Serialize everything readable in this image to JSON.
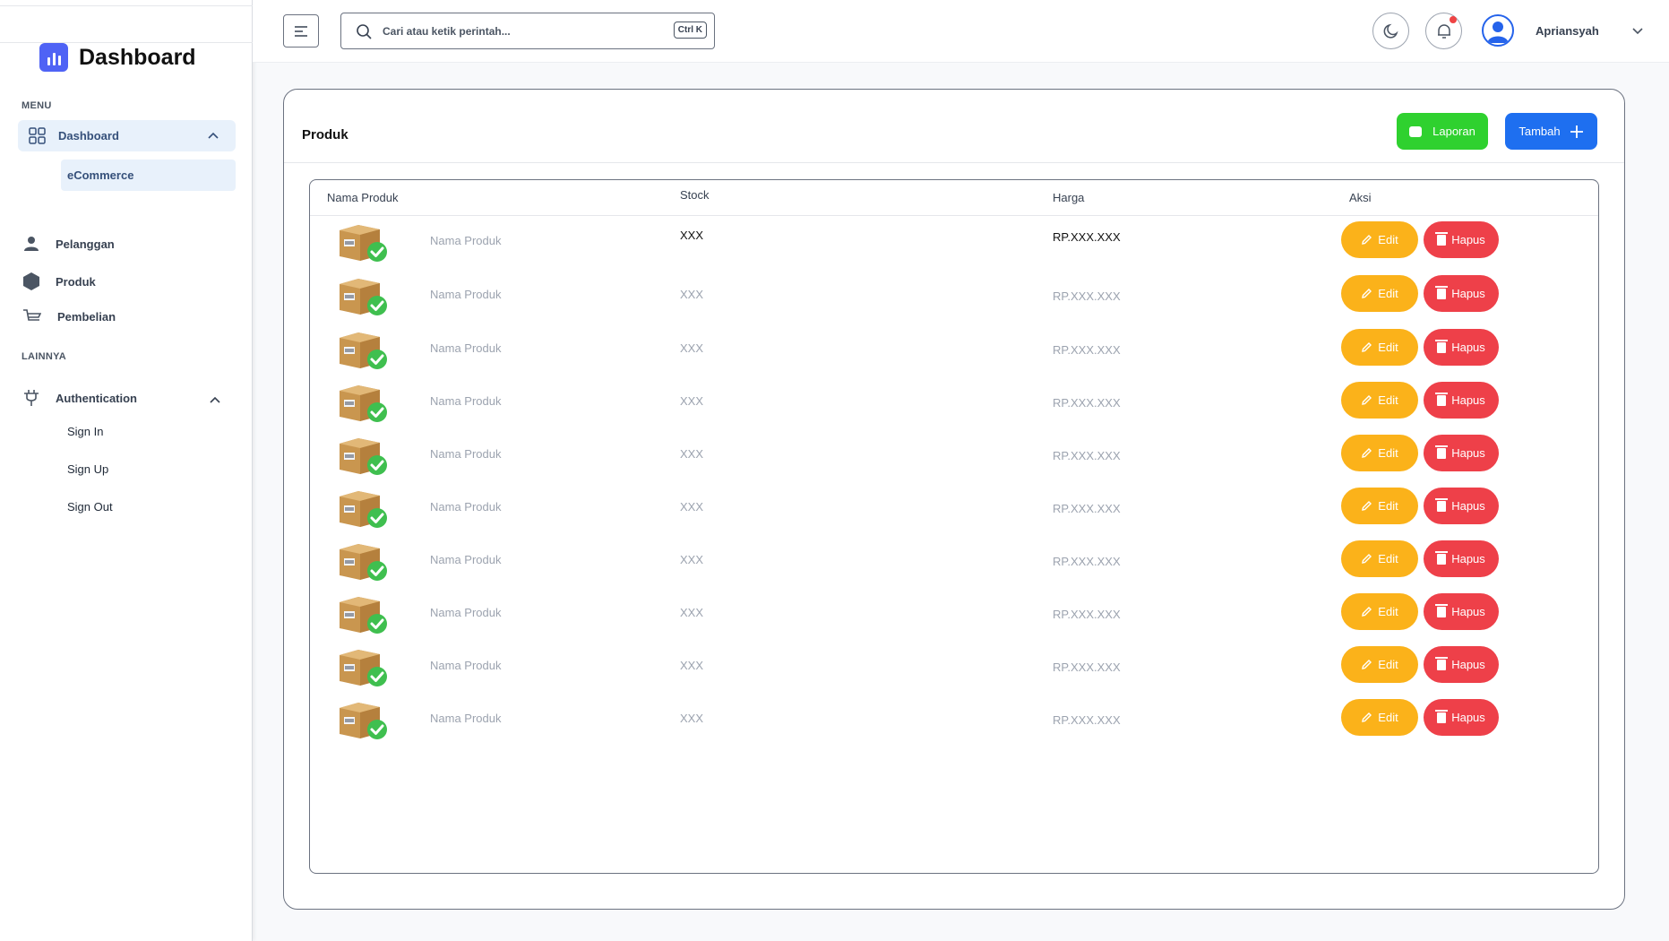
{
  "app": {
    "title": "Dashboard"
  },
  "sidebar": {
    "menu_label": "MENU",
    "dashboard_label": "Dashboard",
    "dashboard_sub": "eCommerce",
    "items": [
      {
        "label": "Pelanggan",
        "icon": "user-icon"
      },
      {
        "label": "Produk",
        "icon": "hexagon-icon"
      },
      {
        "label": "Pembelian",
        "icon": "cart-icon"
      }
    ],
    "other_label": "LAINNYA",
    "auth_label": "Authentication",
    "auth_items": [
      "Sign In",
      "Sign Up",
      "Sign Out"
    ]
  },
  "topbar": {
    "search_placeholder": "Cari atau ketik perintah...",
    "shortcut": "Ctrl K",
    "username": "Apriansyah"
  },
  "card": {
    "title": "Produk",
    "report_label": "Laporan",
    "add_label": "Tambah"
  },
  "table": {
    "headers": {
      "name": "Nama Produk",
      "stock": "Stock",
      "price": "Harga",
      "action": "Aksi"
    },
    "edit_label": "Edit",
    "delete_label": "Hapus",
    "rows": [
      {
        "name": "Nama Produk",
        "stock": "XXX",
        "price": "RP.XXX.XXX"
      },
      {
        "name": "Nama Produk",
        "stock": "XXX",
        "price": "RP.XXX.XXX"
      },
      {
        "name": "Nama Produk",
        "stock": "XXX",
        "price": "RP.XXX.XXX"
      },
      {
        "name": "Nama Produk",
        "stock": "XXX",
        "price": "RP.XXX.XXX"
      },
      {
        "name": "Nama Produk",
        "stock": "XXX",
        "price": "RP.XXX.XXX"
      },
      {
        "name": "Nama Produk",
        "stock": "XXX",
        "price": "RP.XXX.XXX"
      },
      {
        "name": "Nama Produk",
        "stock": "XXX",
        "price": "RP.XXX.XXX"
      },
      {
        "name": "Nama Produk",
        "stock": "XXX",
        "price": "RP.XXX.XXX"
      },
      {
        "name": "Nama Produk",
        "stock": "XXX",
        "price": "RP.XXX.XXX"
      },
      {
        "name": "Nama Produk",
        "stock": "XXX",
        "price": "RP.XXX.XXX"
      }
    ]
  },
  "colors": {
    "accent": "#1e6ff0",
    "report": "#2fd12f",
    "edit": "#fbb21a",
    "delete": "#ee4049"
  }
}
